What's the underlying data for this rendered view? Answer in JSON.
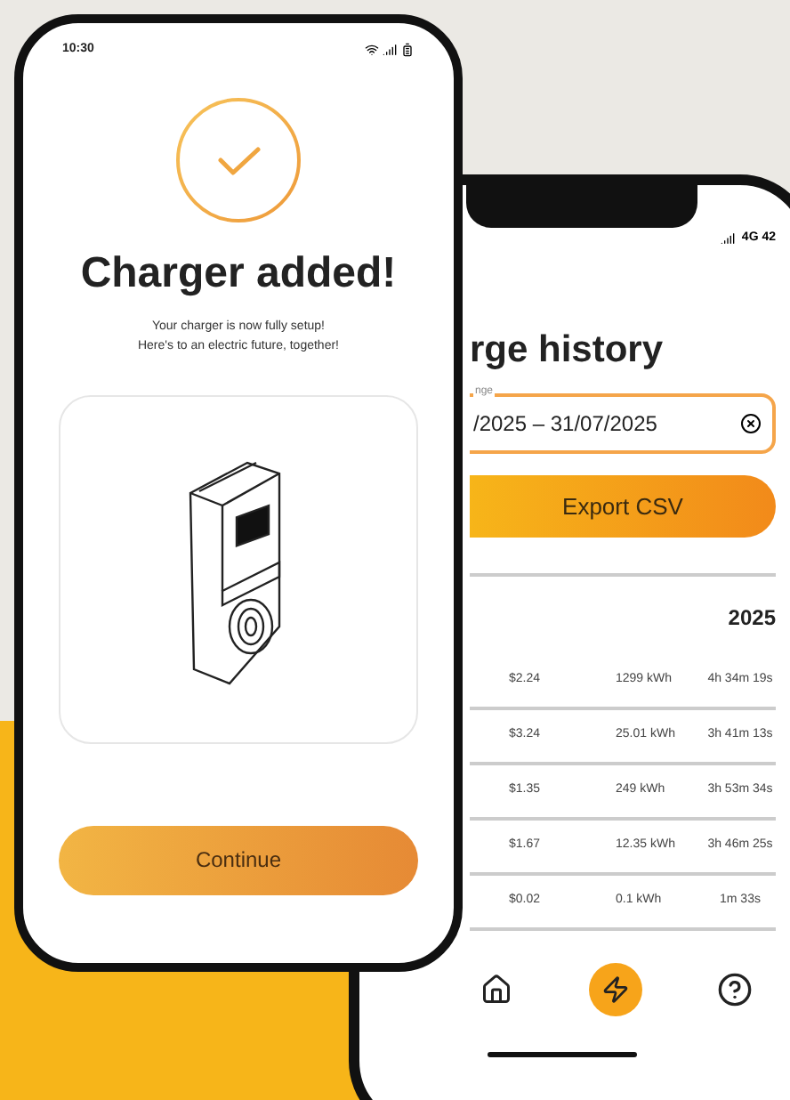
{
  "front_phone": {
    "status_bar": {
      "time": "10:30"
    },
    "title": "Charger added!",
    "message_lines": [
      "Your charger is now fully setup!",
      "Here's to an electric future, together!"
    ],
    "continue_button": "Continue"
  },
  "back_phone": {
    "status_bar": {
      "network": "4G 42"
    },
    "title": "rge history",
    "date_range": {
      "label": "nge",
      "value": "/2025 – 31/07/2025"
    },
    "export_button": "Export CSV",
    "year": "2025",
    "rows": [
      {
        "cost": "$2.24",
        "energy": "1299 kWh",
        "duration": "4h 34m 19s"
      },
      {
        "cost": "$3.24",
        "energy": "25.01 kWh",
        "duration": "3h 41m 13s"
      },
      {
        "cost": "$1.35",
        "energy": "249 kWh",
        "duration": "3h 53m 34s"
      },
      {
        "cost": "$1.67",
        "energy": "12.35 kWh",
        "duration": "3h 46m 25s"
      },
      {
        "cost": "$0.02",
        "energy": "0.1 kWh",
        "duration": "1m 33s"
      }
    ],
    "nav": [
      {
        "kind": "home",
        "selected": false
      },
      {
        "kind": "charge",
        "selected": true
      },
      {
        "kind": "help",
        "selected": false
      }
    ]
  }
}
